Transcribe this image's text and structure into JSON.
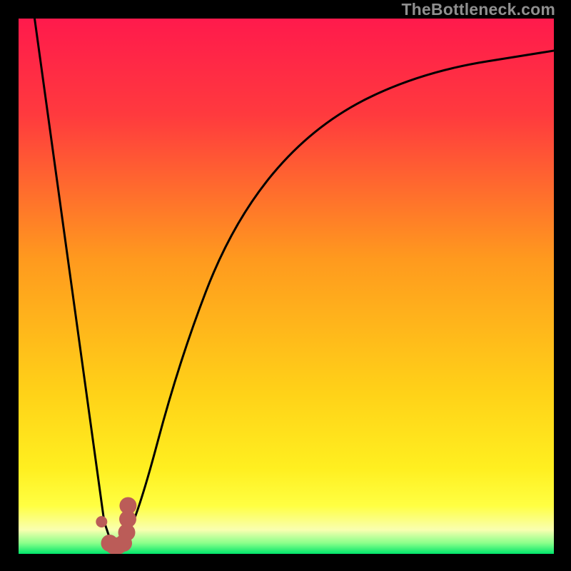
{
  "watermark": "TheBottleneck.com",
  "colors": {
    "black": "#000000",
    "curve": "#000000",
    "marker_fill": "#bb5c58",
    "gradient_top": "#ff1a4c",
    "gradient_mid1": "#ff6b2d",
    "gradient_mid2": "#ffd218",
    "gradient_band_high": "#ffff42",
    "gradient_band_low": "#f9ffb0",
    "gradient_bottom": "#00e66b"
  },
  "chart_data": {
    "type": "line",
    "title": "",
    "xlabel": "",
    "ylabel": "",
    "xlim": [
      0,
      100
    ],
    "ylim": [
      0,
      100
    ],
    "grid": false,
    "series": [
      {
        "name": "bottleneck-curve",
        "x": [
          3,
          16,
          18,
          22,
          30,
          40,
          55,
          75,
          100
        ],
        "values": [
          100,
          6,
          0,
          6,
          36,
          62,
          80,
          90,
          94
        ]
      }
    ],
    "markers": {
      "name": "highlighted-points-J",
      "x": [
        15.5,
        17.0,
        17.8,
        18.6,
        19.6,
        20.2,
        20.4,
        20.45
      ],
      "y": [
        6.0,
        2.0,
        1.5,
        1.5,
        2.0,
        4.0,
        6.5,
        9.0
      ]
    },
    "annotations": []
  }
}
